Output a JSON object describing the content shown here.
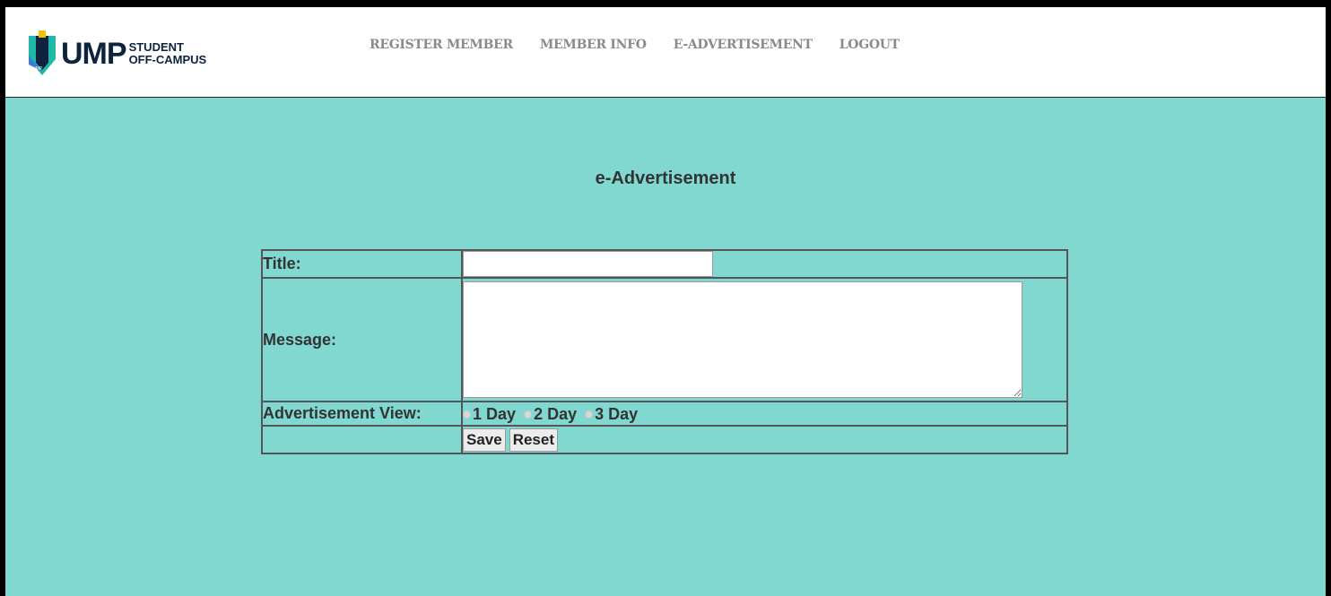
{
  "header": {
    "logo_text": "UMP",
    "logo_sub_line1": "STUDENT",
    "logo_sub_line2": "OFF-CAMPUS",
    "nav": [
      {
        "label": "REGISTER MEMBER"
      },
      {
        "label": "MEMBER INFO"
      },
      {
        "label": "E-ADVERTISEMENT"
      },
      {
        "label": "LOGOUT"
      }
    ]
  },
  "main": {
    "page_title": "e-Advertisement",
    "form": {
      "title_label": "Title:",
      "title_value": "",
      "message_label": "Message:",
      "message_value": "",
      "view_label": "Advertisement View:",
      "view_options": [
        {
          "label": "1 Day"
        },
        {
          "label": "2 Day"
        },
        {
          "label": "3 Day"
        }
      ],
      "save_label": "Save",
      "reset_label": "Reset"
    }
  },
  "colors": {
    "background": "#81d8d0",
    "header_bg": "#ffffff",
    "nav_text": "#8a8a8a",
    "logo_blue": "#0d2340",
    "logo_teal": "#1fb7a6"
  }
}
